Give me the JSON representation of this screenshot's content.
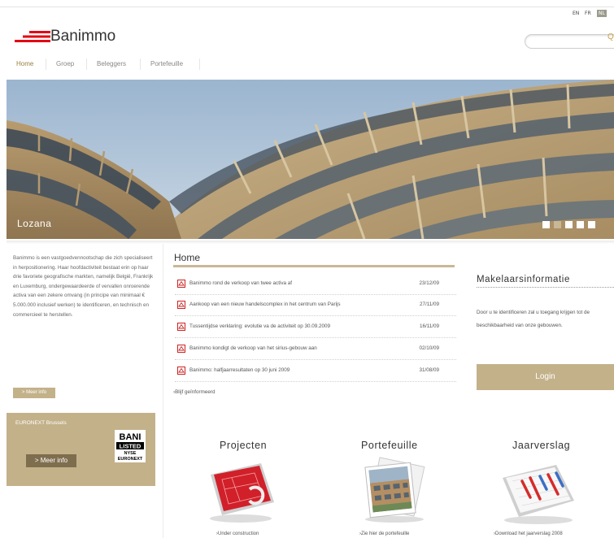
{
  "languages": [
    {
      "label": "EN",
      "active": false
    },
    {
      "label": "FR",
      "active": false
    },
    {
      "label": "NL",
      "active": true
    }
  ],
  "brand": {
    "name": "Banimmo",
    "accent": "#e30613",
    "gold": "#c3b18a"
  },
  "search": {
    "icon": "search-icon",
    "glyph": "Q"
  },
  "nav": [
    {
      "label": "Home",
      "active": true
    },
    {
      "label": "Groep",
      "active": false
    },
    {
      "label": "Beleggers",
      "active": false
    },
    {
      "label": "Portefeuille",
      "active": false
    }
  ],
  "hero": {
    "caption": "Lozana",
    "slides": 5,
    "active_slide": 2
  },
  "intro": {
    "text": "Banimmo is een vastgoedvennootschap die zich specialiseert in herpositionering. Haar hoofdactiviteit bestaat erin op haar drie favoriete geografische markten, namelijk België, Frankrijk en Luxemburg, ondergewaardeerde of vervallen onroerende activa van een zekere omvang (in principe van minimaal € 5.000.000 inclusief werken) te identificeren, en technisch en commercieel te herstellen.",
    "more_label": "> Meer info"
  },
  "euronext": {
    "title": "EURONEXT Brussels",
    "more_label": "> Meer info",
    "logo": {
      "l1": "BANI",
      "l2": "LISTED",
      "l3": "NYSE",
      "l4": "EURONEXT"
    }
  },
  "home": {
    "title": "Home",
    "news": [
      {
        "text": "Banimmo rond de verkoop van twee activa af",
        "date": "23/12/09"
      },
      {
        "text": "Aankoop van een nieuw handelscomplex in het centrum van Parijs",
        "date": "27/11/09"
      },
      {
        "text": "Tussentijdse verklaring: evolutie va de activiteit op 30.09.2009",
        "date": "16/11/09"
      },
      {
        "text": "Banimmo kondigt de verkoop van het sirius-gebouw aan",
        "date": "02/10/09"
      },
      {
        "text": "Banimmo: halfjaarresultaten op 30 juni 2009",
        "date": "31/08/09"
      }
    ],
    "stay_informed": "›Blijf geïnformeerd"
  },
  "makelaars": {
    "title": "Makelaarsinformatie",
    "text": "Door u te identificeren zal u toegang krijgen tot de beschikbaarheid van onze gebouwen.",
    "login_label": "Login"
  },
  "sections": [
    {
      "title": "Projecten",
      "link": "›Under construction"
    },
    {
      "title": "Portefeuille",
      "link": "›Zie hier de portefeuille"
    },
    {
      "title": "Jaarverslag",
      "link": "›Download het jaarverslag 2008"
    }
  ]
}
